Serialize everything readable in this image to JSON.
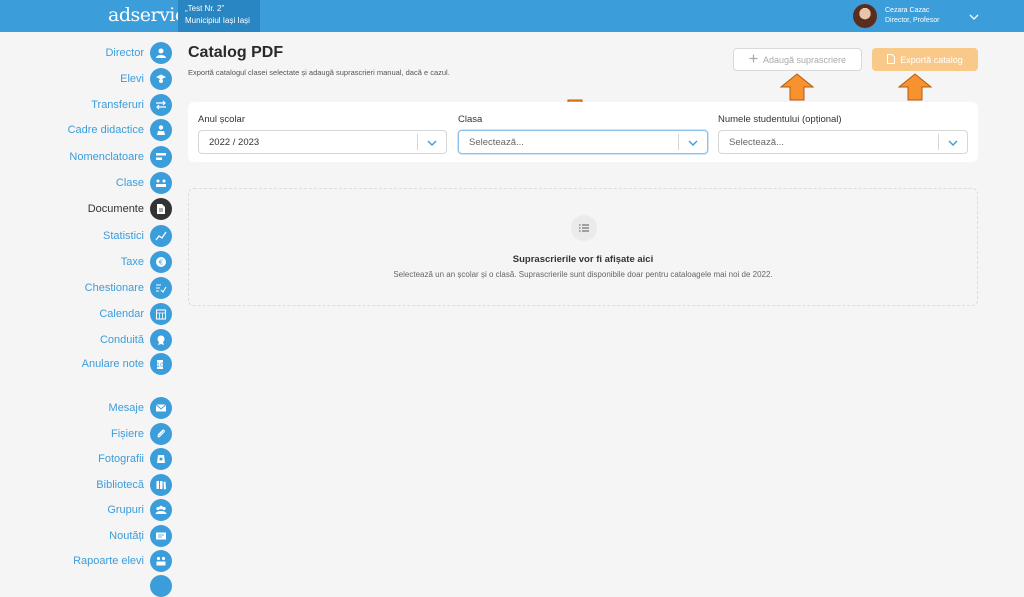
{
  "app": {
    "logo": "adservio"
  },
  "school": {
    "line1": "„Test Nr. 2”",
    "line2": "Municipiul Iași Iași"
  },
  "user": {
    "name": "Cezara Cazac",
    "role": "Director, Profesor"
  },
  "sidebar": {
    "items": [
      {
        "label": "Director",
        "icon": "user-tie-icon"
      },
      {
        "label": "Elevi",
        "icon": "graduate-icon"
      },
      {
        "label": "Transferuri",
        "icon": "transfer-icon"
      },
      {
        "label": "Cadre didactice",
        "icon": "teacher-icon"
      },
      {
        "label": "Nomenclatoare",
        "icon": "list-icon"
      },
      {
        "label": "Clase",
        "icon": "classroom-icon"
      },
      {
        "label": "Documente",
        "icon": "document-icon",
        "active": true
      },
      {
        "label": "Statistici",
        "icon": "chart-icon"
      },
      {
        "label": "Taxe",
        "icon": "euro-icon"
      },
      {
        "label": "Chestionare",
        "icon": "survey-icon"
      },
      {
        "label": "Calendar",
        "icon": "calendar-icon"
      },
      {
        "label": "Conduită",
        "icon": "badge-icon"
      },
      {
        "label": "Anulare note",
        "icon": "cancel-grade-icon"
      },
      {
        "label": "Mesaje",
        "icon": "mail-icon"
      },
      {
        "label": "Fișiere",
        "icon": "paperclip-icon"
      },
      {
        "label": "Fotografii",
        "icon": "photo-icon"
      },
      {
        "label": "Bibliotecă",
        "icon": "books-icon"
      },
      {
        "label": "Grupuri",
        "icon": "group-icon"
      },
      {
        "label": "Noutăți",
        "icon": "news-icon"
      },
      {
        "label": "Rapoarte elevi",
        "icon": "report-icon"
      }
    ]
  },
  "page": {
    "title": "Catalog PDF",
    "subtitle": "Exportă catalogul clasei selectate și adaugă suprascrieri manual, dacă e cazul."
  },
  "actions": {
    "override_label": "Adaugă suprascriere",
    "export_label": "Exportă catalog"
  },
  "filters": {
    "year": {
      "label": "Anul școlar",
      "value": "2022 / 2023"
    },
    "class": {
      "label": "Clasa",
      "placeholder": "Selectează..."
    },
    "student": {
      "label": "Numele studentului (opțional)",
      "placeholder": "Selectează..."
    }
  },
  "empty_state": {
    "title": "Suprascrierile vor fi afișate aici",
    "text": "Selectează un an școlar și o clasă. Suprascrierile sunt disponibile doar pentru cataloagele mai noi de 2022."
  },
  "colors": {
    "primary": "#3c9ddb",
    "accent": "#f9c98a",
    "arrow": "#f7922e"
  }
}
